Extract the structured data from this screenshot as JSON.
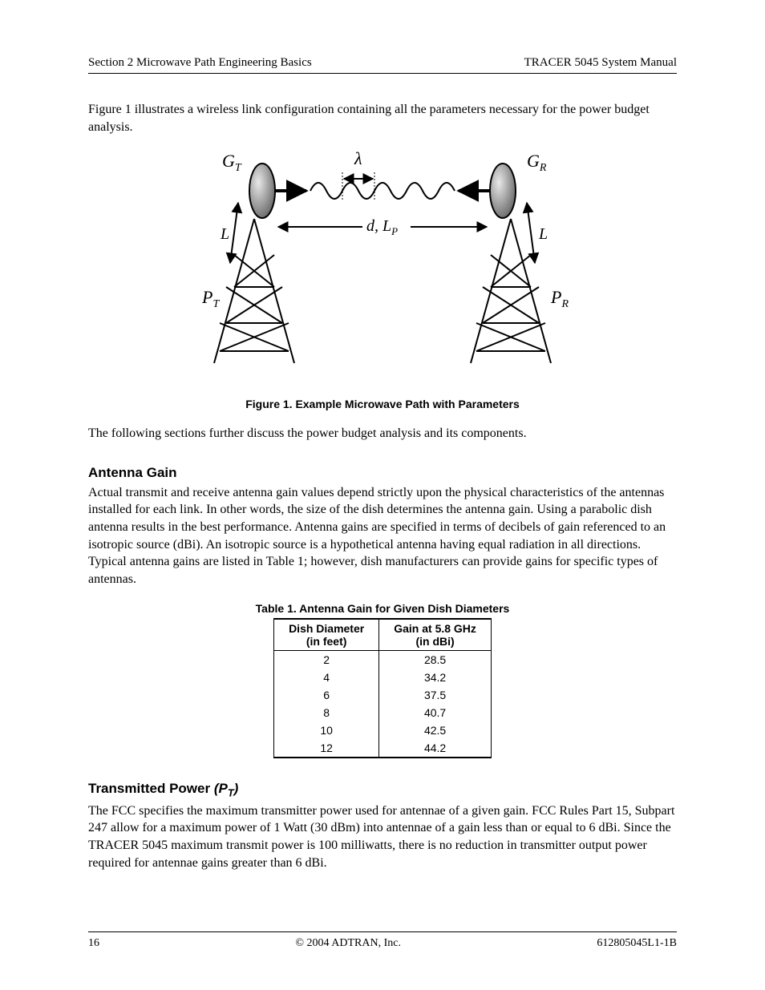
{
  "header": {
    "left": "Section 2  Microwave Path Engineering Basics",
    "right": "TRACER 5045 System Manual"
  },
  "intro_para": "Figure 1 illustrates a wireless link configuration containing all the parameters necessary for the power budget analysis.",
  "figure": {
    "caption": "Figure 1.  Example Microwave Path with Parameters",
    "labels": {
      "GT": "G",
      "GT_sub": "T",
      "GR": "G",
      "GR_sub": "R",
      "PT": "P",
      "PT_sub": "T",
      "PR": "P",
      "PR_sub": "R",
      "L_left": "L",
      "L_right": "L",
      "lambda": "λ",
      "d_lp": "d, L",
      "d_lp_sub": "P"
    }
  },
  "after_figure_para": "The following sections further discuss the power budget analysis and its components.",
  "sec_antenna": {
    "title": "Antenna Gain",
    "para": "Actual transmit and receive antenna gain values depend strictly upon the physical characteristics of the antennas installed for each link. In other words, the size of the dish determines the antenna gain. Using a parabolic dish antenna results in the best performance. Antenna gains are specified in terms of decibels of gain referenced to an isotropic source (dBi). An isotropic source is a hypothetical antenna having equal radiation in all directions. Typical antenna gains are listed in Table 1; however, dish manufacturers can provide gains for specific types of antennas."
  },
  "table": {
    "caption": "Table 1.   Antenna Gain for Given Dish Diameters",
    "head": {
      "c1a": "Dish Diameter",
      "c1b": "(in feet)",
      "c2a": "Gain at 5.8 GHz",
      "c2b": "(in dBi)"
    },
    "rows": [
      {
        "d": "2",
        "g": "28.5"
      },
      {
        "d": "4",
        "g": "34.2"
      },
      {
        "d": "6",
        "g": "37.5"
      },
      {
        "d": "8",
        "g": "40.7"
      },
      {
        "d": "10",
        "g": "42.5"
      },
      {
        "d": "12",
        "g": "44.2"
      }
    ]
  },
  "sec_tx": {
    "title_plain": "Transmitted Power ",
    "title_sym": "(P",
    "title_sub": "T",
    "title_close": ")",
    "para": "The FCC specifies the maximum transmitter power used for antennae of a given gain. FCC Rules Part 15, Subpart 247 allow for a maximum power of 1 Watt (30 dBm) into antennae of a gain less than or equal to 6 dBi. Since the TRACER 5045 maximum transmit power is 100 milliwatts, there is no reduction in transmitter output power required for antennae gains greater than 6 dBi."
  },
  "footer": {
    "left": "16",
    "center": "© 2004 ADTRAN, Inc.",
    "right": "612805045L1-1B"
  }
}
